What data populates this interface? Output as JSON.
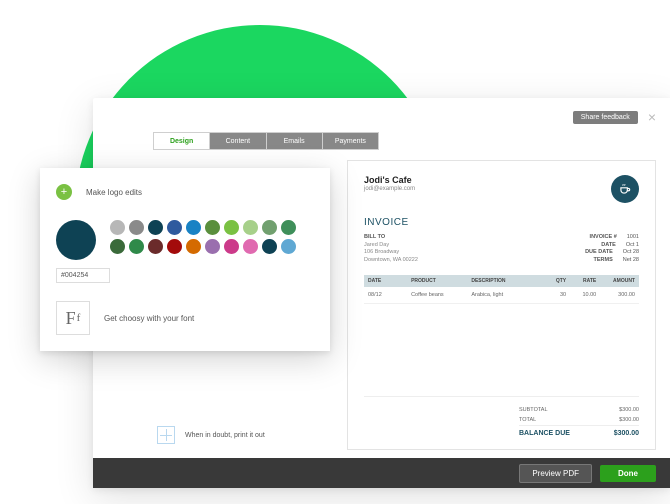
{
  "topbar": {
    "share_feedback": "Share feedback",
    "close_symbol": "×"
  },
  "tabs": {
    "design": "Design",
    "content": "Content",
    "emails": "Emails",
    "payments": "Payments"
  },
  "design_panel": {
    "logo_label": "Make logo edits",
    "plus_symbol": "+",
    "selected_hex": "#004254",
    "font_label": "Get choosy with your font",
    "font_sample_big": "F",
    "font_sample_small": "f",
    "swatches": [
      "#b7b7b7",
      "#8a8a8a",
      "#0e4254",
      "#2f5a9e",
      "#1982c4",
      "#5a8f3d",
      "#7ac143",
      "#a7d08a",
      "#71a06f",
      "#3f8f5a",
      "#3a6a3a",
      "#2f8a4a",
      "#6b2b2b",
      "#a30b0b",
      "#d46a00",
      "#9a6fae",
      "#cc3a8a",
      "#e06ab0",
      "#0e4254",
      "#5fa8d3"
    ]
  },
  "print_hint": "When in doubt, print it out",
  "invoice": {
    "company": "Jodi's Cafe",
    "email": "jodi@example.com",
    "title": "INVOICE",
    "bill_to_label": "BILL TO",
    "bill_to": {
      "name": "Jared Day",
      "street": "106 Broadway",
      "city": "Downtown, WA 00222"
    },
    "meta": {
      "invoice_no_label": "INVOICE #",
      "invoice_no": "1001",
      "date_label": "DATE",
      "date": "Oct 1",
      "due_label": "DUE DATE",
      "due": "Oct 28",
      "terms_label": "TERMS",
      "terms": "Net 28"
    },
    "columns": {
      "date": "DATE",
      "product": "PRODUCT",
      "description": "DESCRIPTION",
      "qty": "QTY",
      "rate": "RATE",
      "amount": "AMOUNT"
    },
    "line": {
      "date": "08/12",
      "product": "Coffee beans",
      "description": "Arabica, light",
      "qty": "30",
      "rate": "10.00",
      "amount": "300.00"
    },
    "totals": {
      "subtotal_label": "SUBTOTAL",
      "subtotal": "$300.00",
      "total_label": "TOTAL",
      "total": "$300.00",
      "balance_label": "BALANCE DUE",
      "balance": "$300.00"
    }
  },
  "footer": {
    "preview": "Preview PDF",
    "done": "Done"
  }
}
